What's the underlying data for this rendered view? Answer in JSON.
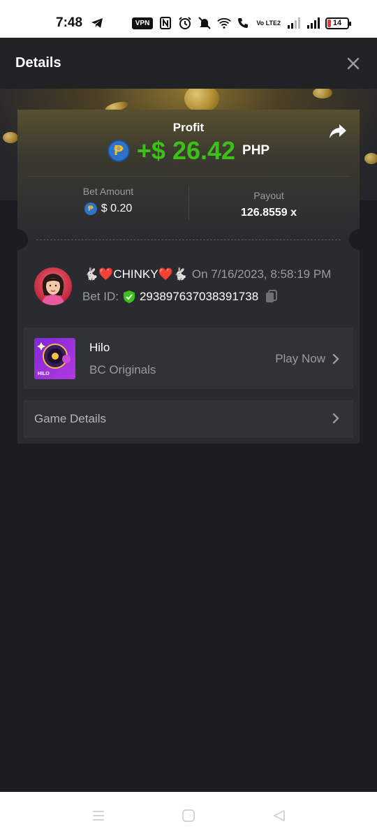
{
  "status_bar": {
    "time": "7:48",
    "vpn": "VPN",
    "volte": "Vo LTE2",
    "battery": "14"
  },
  "header": {
    "title": "Details"
  },
  "profit": {
    "label": "Profit",
    "coin_symbol": "₱",
    "amount": "+$ 26.42",
    "currency": "PHP"
  },
  "bet_amount": {
    "label": "Bet Amount",
    "value": "$ 0.20"
  },
  "payout": {
    "label": "Payout",
    "value": "126.8559 x"
  },
  "user": {
    "name": "🐇❤️CHINKY❤️🐇",
    "date": "On 7/16/2023, 8:58:19 PM",
    "bet_id_label": "Bet ID:",
    "bet_id": "293897637038391738"
  },
  "game": {
    "title": "Hilo",
    "provider": "BC Originals",
    "thumb_text": "HILO",
    "play_label": "Play Now"
  },
  "game_details": {
    "label": "Game Details"
  },
  "colors": {
    "profit_green": "#3bc117",
    "background": "#1c1d20",
    "card": "#2a2b30"
  }
}
